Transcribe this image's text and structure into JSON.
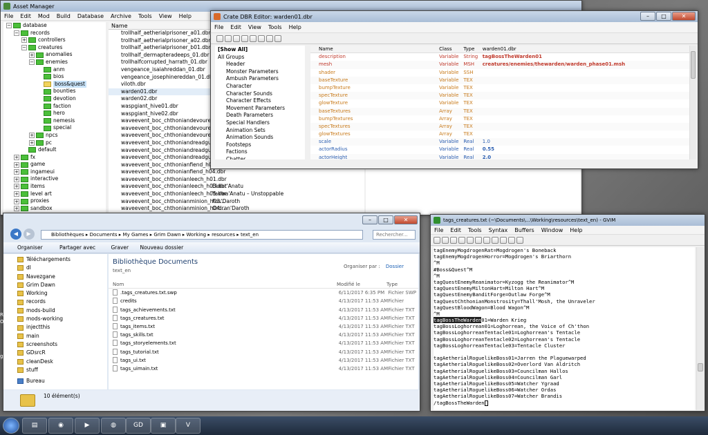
{
  "asset_manager": {
    "title": "Asset Manager",
    "menu": [
      "File",
      "Edit",
      "Mod",
      "Build",
      "Database",
      "Archive",
      "Tools",
      "View",
      "Help"
    ],
    "tree": [
      {
        "label": "database",
        "depth": 0,
        "toggle": "−"
      },
      {
        "label": "records",
        "depth": 1,
        "toggle": "−"
      },
      {
        "label": "controllers",
        "depth": 2,
        "toggle": "+"
      },
      {
        "label": "creatures",
        "depth": 2,
        "toggle": "−"
      },
      {
        "label": "anomalies",
        "depth": 3,
        "toggle": "+"
      },
      {
        "label": "enemies",
        "depth": 3,
        "toggle": "−"
      },
      {
        "label": "anm",
        "depth": 4,
        "toggle": ""
      },
      {
        "label": "bios",
        "depth": 4,
        "toggle": ""
      },
      {
        "label": "boss&quest",
        "depth": 4,
        "toggle": "",
        "selected": true
      },
      {
        "label": "bounties",
        "depth": 4,
        "toggle": ""
      },
      {
        "label": "devotion",
        "depth": 4,
        "toggle": ""
      },
      {
        "label": "faction",
        "depth": 4,
        "toggle": ""
      },
      {
        "label": "hero",
        "depth": 4,
        "toggle": ""
      },
      {
        "label": "nemesis",
        "depth": 4,
        "toggle": ""
      },
      {
        "label": "special",
        "depth": 4,
        "toggle": ""
      },
      {
        "label": "npcs",
        "depth": 3,
        "toggle": "+"
      },
      {
        "label": "pc",
        "depth": 3,
        "toggle": "+"
      },
      {
        "label": "default",
        "depth": 2,
        "toggle": ""
      },
      {
        "label": "fx",
        "depth": 1,
        "toggle": "+"
      },
      {
        "label": "game",
        "depth": 1,
        "toggle": "+"
      },
      {
        "label": "ingameui",
        "depth": 1,
        "toggle": "+"
      },
      {
        "label": "interactive",
        "depth": 1,
        "toggle": "+"
      },
      {
        "label": "items",
        "depth": 1,
        "toggle": "+"
      },
      {
        "label": "level art",
        "depth": 1,
        "toggle": "+"
      },
      {
        "label": "proxies",
        "depth": 1,
        "toggle": "+"
      },
      {
        "label": "sandbox",
        "depth": 1,
        "toggle": "+"
      }
    ],
    "list_header": "Name",
    "files": [
      "trollhalf_aetherialprisoner_a01.dbr",
      "trollhalf_aetherialprisoner_a02.dbr",
      "trollhalf_aetherialprisoner_b01.dbr",
      "trollhalf_dermapteradeeps_01.dbr",
      "trollhalfcorrupted_harrath_01.dbr",
      "vengeance_isaiahreddan_01.dbr",
      "vengeance_josephinereddan_01.dbr",
      "viloth.dbr",
      "warden01.dbr",
      "warden02.dbr",
      "waspgiant_hive01.dbr",
      "waspgiant_hive02.dbr",
      "waveevent_boc_chthoniandevourer_h0...",
      "waveevent_boc_chthoniandevourer_h0...",
      "waveevent_boc_chthoniandevourer_h0...",
      "waveevent_boc_chthoniandreadguard_...",
      "waveevent_boc_chthoniandreadguard_...",
      "waveevent_boc_chthoniandreadguard_...",
      "waveevent_boc_chthonianfiend_h03.dbr",
      "waveevent_boc_chthonianfiend_h04.dbr",
      "waveevent_boc_chthonianleech_h01.dbr",
      "waveevent_boc_chthonianleech_h03.dbr",
      "waveevent_boc_chthonianleech_h05.dbr",
      "waveevent_boc_chthonianminion_h03...",
      "waveevent_boc_chthonianminion_h04...",
      "waveevent_boc_chthonianminion_h05..."
    ],
    "desc_col": [
      "",
      "",
      "",
      "",
      "",
      "",
      "",
      "",
      "",
      "",
      "",
      "",
      "",
      "",
      "",
      "",
      "",
      "",
      "",
      "",
      "",
      "Ekket'Anatu",
      "Yakwa'Anatu – Unstoppable",
      "Fos'Daroth",
      "Ordran'Daroth",
      "Pulv'Daroth"
    ],
    "side_fragment": "Re"
  },
  "dbr_editor": {
    "title": "Crate DBR Editor: warden01.dbr",
    "menu": [
      "File",
      "Edit",
      "View",
      "Tools",
      "Help"
    ],
    "groups": [
      "[Show All]",
      "All Groups",
      "Header",
      "Monster Parameters",
      "Ambush Parameters",
      "Character",
      "Character Sounds",
      "Character Effects",
      "Movement Parameters",
      "Death Parameters",
      "Special Handlers",
      "Animation Sets",
      "Animation Sounds",
      "Footsteps",
      "Factions",
      "Chatter",
      "Actor Variables",
      "Physics"
    ],
    "columns": {
      "name": "Name",
      "class": "Class",
      "type": "Type",
      "value": "warden01.dbr"
    },
    "rows": [
      {
        "name": "description",
        "class": "Variable",
        "type": "String",
        "value": "tagBossTheWarden01",
        "color": "#c0392b",
        "bold": true
      },
      {
        "name": "mesh",
        "class": "Variable",
        "type": "MSH",
        "value": "creatures/enemies/thewarden/warden_phase01.msh",
        "color": "#c0392b",
        "bold": true
      },
      {
        "name": "shader",
        "class": "Variable",
        "type": "SSH",
        "value": "",
        "color": "#c87a1a"
      },
      {
        "name": "baseTexture",
        "class": "Variable",
        "type": "TEX",
        "value": "",
        "color": "#c87a1a"
      },
      {
        "name": "bumpTexture",
        "class": "Variable",
        "type": "TEX",
        "value": "",
        "color": "#c87a1a"
      },
      {
        "name": "specTexture",
        "class": "Variable",
        "type": "TEX",
        "value": "",
        "color": "#c87a1a"
      },
      {
        "name": "glowTexture",
        "class": "Variable",
        "type": "TEX",
        "value": "",
        "color": "#c87a1a"
      },
      {
        "name": "baseTextures",
        "class": "Array",
        "type": "TEX",
        "value": "",
        "color": "#c87a1a"
      },
      {
        "name": "bumpTextures",
        "class": "Array",
        "type": "TEX",
        "value": "",
        "color": "#c87a1a"
      },
      {
        "name": "specTextures",
        "class": "Array",
        "type": "TEX",
        "value": "",
        "color": "#c87a1a"
      },
      {
        "name": "glowTextures",
        "class": "Array",
        "type": "TEX",
        "value": "",
        "color": "#c87a1a"
      },
      {
        "name": "scale",
        "class": "Variable",
        "type": "Real",
        "value": "1.0",
        "color": "#2a5db0"
      },
      {
        "name": "actorRadius",
        "class": "Variable",
        "type": "Real",
        "value": "0.55",
        "color": "#2a5db0",
        "bold": true
      },
      {
        "name": "actorHeight",
        "class": "Variable",
        "type": "Real",
        "value": "2.0",
        "color": "#2a5db0",
        "bold": true
      }
    ]
  },
  "explorer": {
    "breadcrumb": [
      "Bibliothèques",
      "Documents",
      "My Games",
      "Grim Dawn",
      "Working",
      "resources",
      "text_en"
    ],
    "search_placeholder": "Rechercher...",
    "toolbar": {
      "organize": "Organiser",
      "share": "Partager avec",
      "burn": "Graver",
      "new_folder": "Nouveau dossier"
    },
    "sidebar": [
      "Téléchargements",
      "dl",
      "Navezgane",
      "Grim Dawn",
      "Working",
      "records",
      "mods-build",
      "mods-working",
      "injectthis",
      "main",
      "screenshots",
      "GDsrcR",
      "cleanDesk",
      "stuff",
      "Bureau"
    ],
    "library_title": "Bibliothèque Documents",
    "library_sub": "text_en",
    "arrange_label": "Organiser par :",
    "arrange_value": "Dossier",
    "columns": {
      "name": "Nom",
      "modified": "Modifié le",
      "type": "Type"
    },
    "files": [
      {
        "name": ".tags_creatures.txt.swp",
        "date": "6/11/2017 6:35 PM",
        "type": "Fichier SWP"
      },
      {
        "name": "credits",
        "date": "4/13/2017 11:53 AM",
        "type": "Fichier"
      },
      {
        "name": "tags_achievements.txt",
        "date": "4/13/2017 11:53 AM",
        "type": "Fichier TXT"
      },
      {
        "name": "tags_creatures.txt",
        "date": "4/13/2017 11:53 AM",
        "type": "Fichier TXT"
      },
      {
        "name": "tags_items.txt",
        "date": "4/13/2017 11:53 AM",
        "type": "Fichier TXT"
      },
      {
        "name": "tags_skills.txt",
        "date": "4/13/2017 11:53 AM",
        "type": "Fichier TXT"
      },
      {
        "name": "tags_storyelements.txt",
        "date": "4/13/2017 11:53 AM",
        "type": "Fichier TXT"
      },
      {
        "name": "tags_tutorial.txt",
        "date": "4/13/2017 11:53 AM",
        "type": "Fichier TXT"
      },
      {
        "name": "tags_ui.txt",
        "date": "4/13/2017 11:53 AM",
        "type": "Fichier TXT"
      },
      {
        "name": "tags_uimain.txt",
        "date": "4/13/2017 11:53 AM",
        "type": "Fichier TXT"
      }
    ],
    "status": "10 élément(s)"
  },
  "gvim": {
    "title": "tags_creatures.txt (~\\Documents\\...\\Working\\resources\\text_en) - GVIM",
    "menu": [
      "File",
      "Edit",
      "Tools",
      "Syntax",
      "Buffers",
      "Window",
      "Help"
    ],
    "lines": [
      "tagEnemyMogdrogenRat=Mogdrogen's Boneback",
      "tagEnemyMogdrogenHorror=Mogdrogen's Briarthorn",
      "^M",
      "#Boss&Quest^M",
      "^M",
      "tagQuestEnemyReanimator=Kyzogg the Reanimator^M",
      "tagQuestEnemyMiltonHart=Milton Hart^M",
      "tagQuestEnemyBanditForge=Outlaw Forge^M",
      "tagQuestChthonianMonstrosity=Thall'Mosh, the Unraveler",
      "tagQuestBloodWagon=Blood Wagon^M",
      "^M",
      "tagBossTheWarden01=Warden Krieg",
      "tagBossLoghorrean01=Loghorrean, the Voice of Ch'thon",
      "tagBossLoghorreanTentacle01=Loghorrean's Tentacle",
      "tagBossLoghorreanTentacle02=Loghorrean's Tentacle",
      "tagBossLoghorreanTentacle03=Tentacle Cluster",
      "",
      "tagAetherialRoguelikeBoss01=Jarren the Plaguewarped",
      "tagAetherialRoguelikeBoss02=Overlord Van Aldritch",
      "tagAetherialRoguelikeBoss03=Councilman Hallos",
      "tagAetherialRoguelikeBoss04=Councilman Garl",
      "tagAetherialRoguelikeBoss05=Watcher Ygraad",
      "tagAetherialRoguelikeBoss06=Watcher Ordas",
      "tagAetherialRoguelikeBoss07=Watcher Brandis",
      "/tagBossTheWarden"
    ],
    "highlight": "tagBossTheWarden",
    "highlight_rest": "01=Warden Krieg"
  },
  "desktop_fragments": [
    "Risi",
    "Orci",
    "grin"
  ],
  "taskbar": [
    "start",
    "explorer",
    "chrome",
    "media",
    "network",
    "grimdawn",
    "asset-manager",
    "gvim"
  ]
}
